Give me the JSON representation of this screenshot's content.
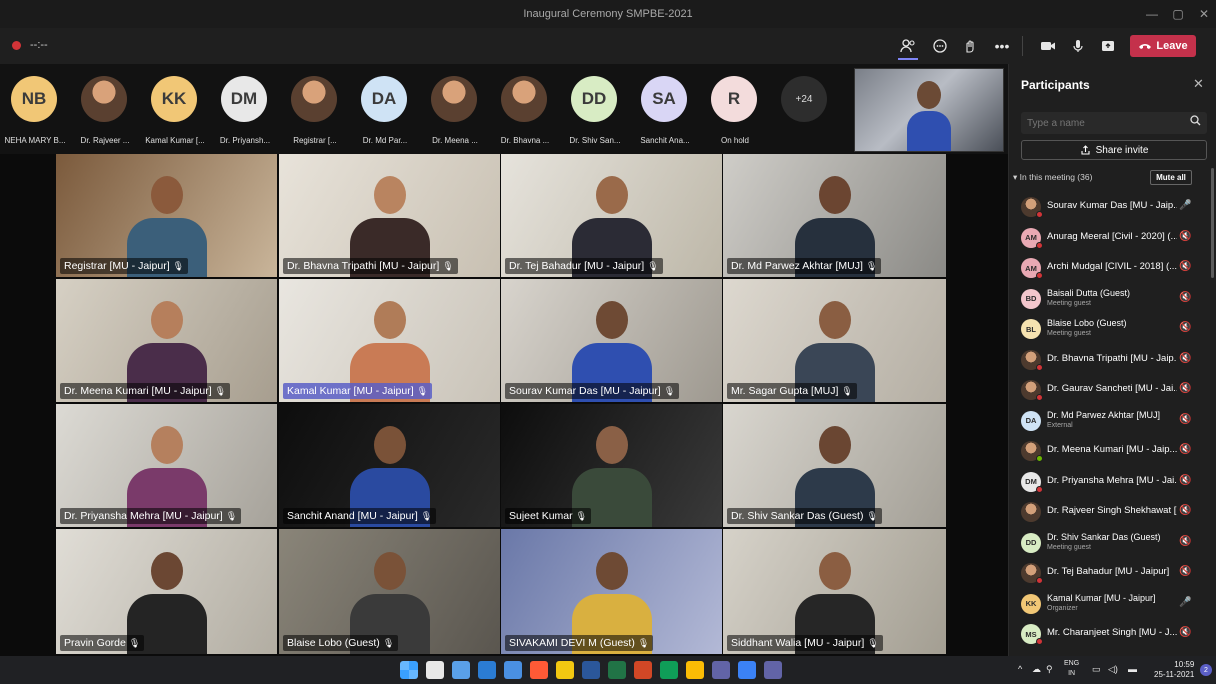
{
  "window": {
    "title": "Inaugural Ceremony SMPBE-2021",
    "minimize": "—",
    "restore": "▢",
    "close": "✕"
  },
  "meeting_bar": {
    "timer": "--:--",
    "leave_label": "Leave"
  },
  "strip": {
    "participants": [
      {
        "initials": "NB",
        "name": "NEHA MARY B...",
        "color": "#f1c776",
        "photo": false
      },
      {
        "initials": "",
        "name": "Dr. Rajveer ...",
        "color": "",
        "photo": true
      },
      {
        "initials": "KK",
        "name": "Kamal Kumar [...",
        "color": "#f1c776",
        "photo": false
      },
      {
        "initials": "DM",
        "name": "Dr. Priyansh...",
        "color": "#e8e8e8",
        "photo": false
      },
      {
        "initials": "",
        "name": "Registrar [...",
        "color": "",
        "photo": true
      },
      {
        "initials": "DA",
        "name": "Dr. Md Par...",
        "color": "#cfe3f5",
        "photo": false
      },
      {
        "initials": "",
        "name": "Dr. Meena ...",
        "color": "",
        "photo": true
      },
      {
        "initials": "",
        "name": "Dr. Bhavna ...",
        "color": "",
        "photo": true
      },
      {
        "initials": "DD",
        "name": "Dr. Shiv San...",
        "color": "#d8ecc4",
        "photo": false
      },
      {
        "initials": "SA",
        "name": "Sanchit Ana...",
        "color": "#d9d6f5",
        "photo": false
      },
      {
        "initials": "R",
        "name": "On hold",
        "color": "#f3dcdc",
        "photo": false
      }
    ],
    "more_count": "+24"
  },
  "tiles": [
    {
      "label": "Registrar [MU - Jaipur]",
      "bg": [
        "#7b5a3c",
        "#c9b59a"
      ],
      "skin": "#8b5a3c",
      "shirt": "#3b5f7a",
      "highlight": false
    },
    {
      "label": "Dr. Bhavna Tripathi [MU - Jaipur]",
      "bg": [
        "#e8e3da",
        "#c8c0b2"
      ],
      "skin": "#b98460",
      "shirt": "#3a2a28",
      "highlight": false
    },
    {
      "label": "Dr. Tej Bahadur [MU - Jaipur]",
      "bg": [
        "#e6e3dc",
        "#bdb7a8"
      ],
      "skin": "#9a6a4a",
      "shirt": "#2b2b35",
      "highlight": false
    },
    {
      "label": "Dr. Md Parwez Akhtar [MUJ]",
      "bg": [
        "#cfcdc8",
        "#8b8a86"
      ],
      "skin": "#6b4531",
      "shirt": "#26303d",
      "highlight": false
    },
    {
      "label": "Dr. Meena Kumari [MU - Jaipur]",
      "bg": [
        "#d6d0c4",
        "#a79e8f"
      ],
      "skin": "#b67f5c",
      "shirt": "#4a2d4a",
      "highlight": false
    },
    {
      "label": "Kamal Kumar [MU - Jaipur]",
      "bg": [
        "#e9e6e0",
        "#c9c3b8"
      ],
      "skin": "#b07c58",
      "shirt": "#c97b55",
      "highlight": true
    },
    {
      "label": "Sourav Kumar Das [MU - Jaipur]",
      "bg": [
        "#d8d4cd",
        "#9e9990"
      ],
      "skin": "#6e4a34",
      "shirt": "#2f4fb0",
      "highlight": false
    },
    {
      "label": "Mr. Sagar Gupta [MUJ]",
      "bg": [
        "#ddd8cf",
        "#b4aea3"
      ],
      "skin": "#8a5e42",
      "shirt": "#3a4656",
      "highlight": false
    },
    {
      "label": "Dr. Priyansha Mehra [MU - Jaipur]",
      "bg": [
        "#dcdad4",
        "#a6a29a"
      ],
      "skin": "#b5805e",
      "shirt": "#7a3a6a",
      "highlight": false
    },
    {
      "label": "Sanchit Anand [MU - Jaipur]",
      "bg": [
        "#0d0d0d",
        "#2a2a2a"
      ],
      "skin": "#7a5238",
      "shirt": "#2a4aa0",
      "highlight": false
    },
    {
      "label": "Sujeet Kumar",
      "bg": [
        "#0d0d0d",
        "#3a3a3a"
      ],
      "skin": "#8a6046",
      "shirt": "#3a4a3a",
      "highlight": false
    },
    {
      "label": "Dr. Shiv Sankar Das (Guest)",
      "bg": [
        "#d9d6cf",
        "#a39f96"
      ],
      "skin": "#6a4632",
      "shirt": "#2d3a4a",
      "highlight": false
    },
    {
      "label": "Pravin Gorde",
      "bg": [
        "#e0ddd6",
        "#b2ada2"
      ],
      "skin": "#6b4733",
      "shirt": "#242424",
      "highlight": false
    },
    {
      "label": "Blaise Lobo (Guest)",
      "bg": [
        "#8a8579",
        "#5a564f"
      ],
      "skin": "#7a5238",
      "shirt": "#3a3a3a",
      "highlight": false
    },
    {
      "label": "SIVAKAMI DEVI M (Guest)",
      "bg": [
        "#6a78a8",
        "#b3b9d6"
      ],
      "skin": "#6e4a34",
      "shirt": "#d9b040",
      "highlight": false
    },
    {
      "label": "Siddhant Walia [MU - Jaipur]",
      "bg": [
        "#d6d2c9",
        "#a39e92"
      ],
      "skin": "#8b5e42",
      "shirt": "#262626",
      "highlight": false
    }
  ],
  "panel": {
    "title": "Participants",
    "close": "✕",
    "search_placeholder": "Type a name",
    "share_invite": "Share invite",
    "in_meeting": "In this meeting (36)",
    "mute_all": "Mute all",
    "list": [
      {
        "name": "Sourav Kumar Das [MU - Jaip...",
        "sub": "",
        "initials": "",
        "color": "",
        "photo": true,
        "mic": "🎤",
        "status": "#d13438"
      },
      {
        "name": "Anurag Meeral [Civil - 2020] (...",
        "sub": "",
        "initials": "AM",
        "color": "#e9a9b4",
        "photo": false,
        "mic": "🔇",
        "status": "#d13438"
      },
      {
        "name": "Archi Mudgal [CIVIL - 2018] (...",
        "sub": "",
        "initials": "AM",
        "color": "#e9a9b4",
        "photo": false,
        "mic": "🔇",
        "status": "#d13438"
      },
      {
        "name": "Baisali Dutta (Guest)",
        "sub": "Meeting guest",
        "initials": "BD",
        "color": "#f3c6cc",
        "photo": false,
        "mic": "🔇",
        "status": ""
      },
      {
        "name": "Blaise Lobo (Guest)",
        "sub": "Meeting guest",
        "initials": "BL",
        "color": "#f6e3b0",
        "photo": false,
        "mic": "🔇",
        "status": ""
      },
      {
        "name": "Dr. Bhavna Tripathi [MU - Jaip...",
        "sub": "",
        "initials": "",
        "color": "",
        "photo": true,
        "mic": "🔇",
        "status": "#d13438"
      },
      {
        "name": "Dr. Gaurav Sancheti [MU - Jai...",
        "sub": "",
        "initials": "",
        "color": "",
        "photo": true,
        "mic": "🔇",
        "status": "#d13438"
      },
      {
        "name": "Dr. Md Parwez Akhtar [MUJ]",
        "sub": "External",
        "initials": "DA",
        "color": "#cfe3f5",
        "photo": false,
        "mic": "🔇",
        "status": ""
      },
      {
        "name": "Dr. Meena Kumari [MU - Jaip...",
        "sub": "",
        "initials": "",
        "color": "",
        "photo": true,
        "mic": "🔇",
        "status": "#6bb700"
      },
      {
        "name": "Dr. Priyansha Mehra [MU - Jai...",
        "sub": "",
        "initials": "DM",
        "color": "#e8e8e8",
        "photo": false,
        "mic": "🔇",
        "status": "#d13438"
      },
      {
        "name": "Dr. Rajveer Singh Shekhawat [...",
        "sub": "",
        "initials": "",
        "color": "",
        "photo": true,
        "mic": "🔇",
        "status": ""
      },
      {
        "name": "Dr. Shiv Sankar Das (Guest)",
        "sub": "Meeting guest",
        "initials": "DD",
        "color": "#d8ecc4",
        "photo": false,
        "mic": "🔇",
        "status": ""
      },
      {
        "name": "Dr. Tej Bahadur [MU - Jaipur]",
        "sub": "",
        "initials": "",
        "color": "",
        "photo": true,
        "mic": "🔇",
        "status": "#d13438"
      },
      {
        "name": "Kamal Kumar [MU - Jaipur]",
        "sub": "Organizer",
        "initials": "KK",
        "color": "#f1c776",
        "photo": false,
        "mic": "🎤",
        "status": ""
      },
      {
        "name": "Mr. Charanjeet Singh [MU - J...",
        "sub": "",
        "initials": "MS",
        "color": "#d8ecc4",
        "photo": false,
        "mic": "🔇",
        "status": "#d13438"
      }
    ]
  },
  "taskbar": {
    "lang": "ENG",
    "region": "IN",
    "time": "10:59",
    "date": "25-11-2021",
    "notifications": "2",
    "app_colors": [
      "#3aa0ff",
      "#e8e8e8",
      "#5aa0e8",
      "#2b7cd3",
      "#4a90e2",
      "#ff5a36",
      "#f2c811",
      "#2b579a",
      "#217346",
      "#d24726",
      "#0f9d58",
      "#fbbc05",
      "#6264a7",
      "#3b82f6",
      "#6264a7"
    ]
  }
}
